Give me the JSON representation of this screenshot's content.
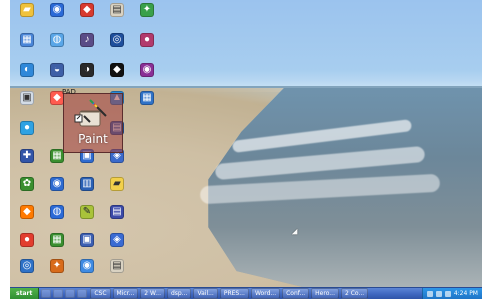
{
  "desktop": {
    "paint_tile": {
      "label": "Paint",
      "small_text": "PAD"
    }
  },
  "taskbar": {
    "start_label": "start",
    "tasks": [
      "CSC",
      "Micr...",
      "2 W...",
      "dsp...",
      "Vail...",
      "PRES...",
      "Word...",
      "Conf...",
      "Hero...",
      "2 Co..."
    ],
    "clock": "4:24 PM"
  }
}
